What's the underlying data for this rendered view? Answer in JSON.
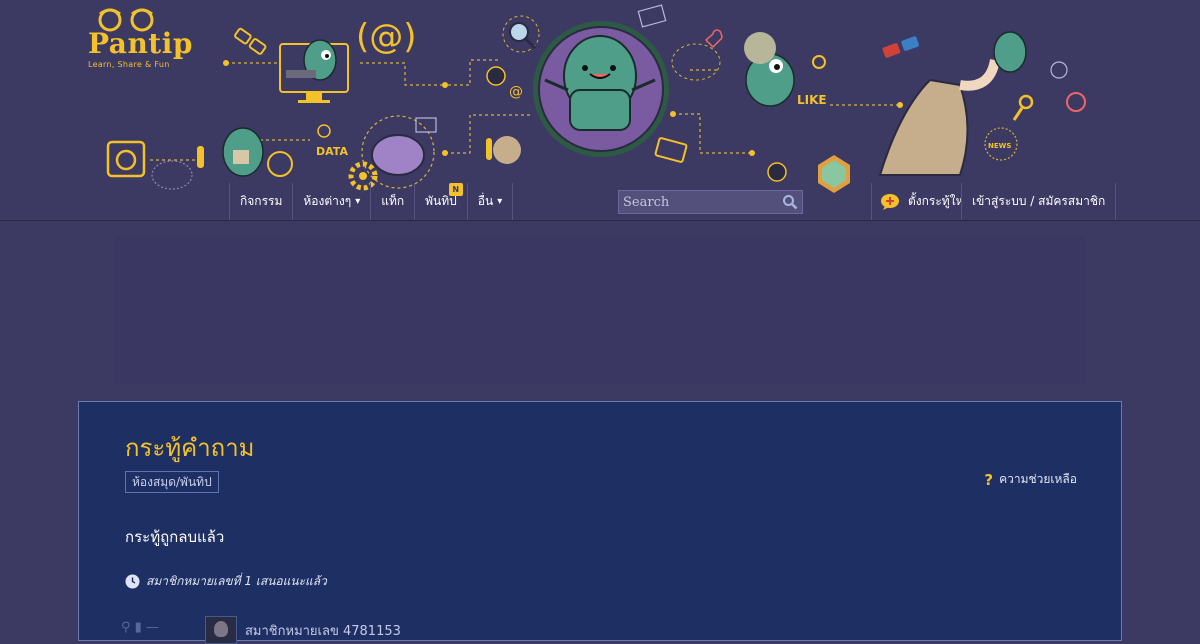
{
  "logo": {
    "brand": "Pantip",
    "tagline": "Learn, Share & Fun"
  },
  "header_art": {
    "labels": {
      "at_sign": "(@)",
      "data_label": "DATA",
      "like_label": "LIKE",
      "news_label": "NEWS",
      "small_at": "@"
    }
  },
  "nav": {
    "items": [
      {
        "label": "กิจกรรม",
        "has_caret": false
      },
      {
        "label": "ห้องต่างๆ",
        "has_caret": true
      },
      {
        "label": "แท็ก",
        "has_caret": false
      },
      {
        "label": "พันทิป",
        "has_caret": false,
        "badge": "N"
      },
      {
        "label": "อื่น",
        "has_caret": true
      }
    ],
    "caret_glyph": "▾",
    "search_placeholder": "Search",
    "create_label": "ตั้งกระทู้ใหม่",
    "login_label": "เข้าสู่ระบบ / สมัครสมาชิก"
  },
  "panel": {
    "room_title": "กระทู้คำถาม",
    "tag": "ห้องสมุด/พันทิป",
    "help_label": "ความช่วยเหลือ",
    "help_glyph": "?",
    "topic_heading": "กระทู้ถูกลบแล้ว",
    "time_text": "สมาชิกหมายเลขที่ 1 เสนอแนะแล้ว",
    "author_text": "สมาชิกหมายเลข 4781153"
  },
  "colors": {
    "background": "#3c3963",
    "accent_yellow": "#f3c12a",
    "panel_bg": "#1e2f63",
    "monster_green": "#4f9e8a"
  }
}
